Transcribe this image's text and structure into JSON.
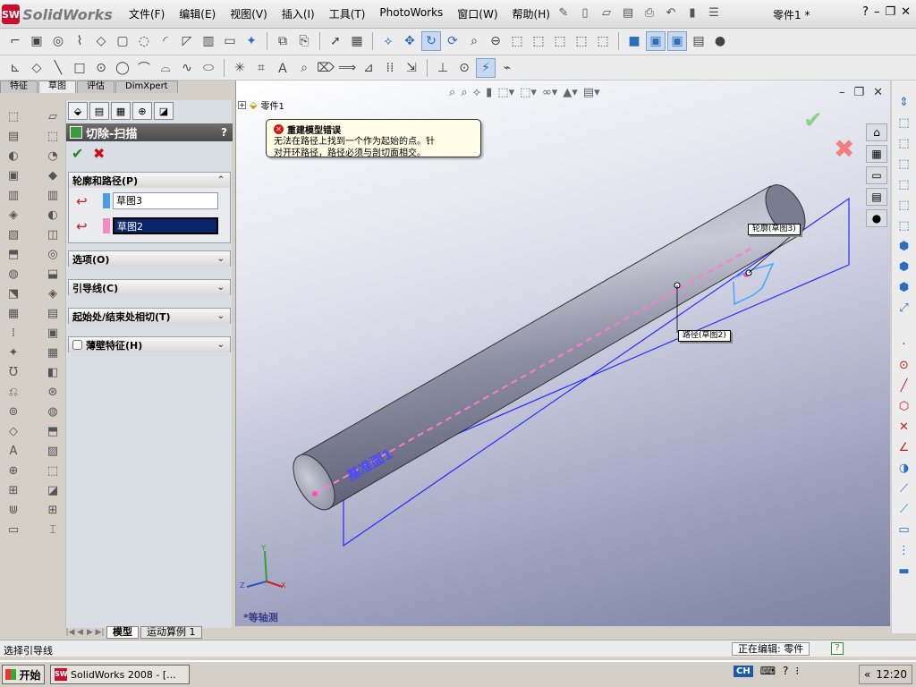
{
  "app": {
    "logo_text": "SolidWorks",
    "menu": [
      "文件(F)",
      "编辑(E)",
      "视图(V)",
      "插入(I)",
      "工具(T)",
      "PhotoWorks",
      "窗口(W)",
      "帮助(H)"
    ],
    "document_title": "零件1 *",
    "help_label": "?"
  },
  "left_tabs": [
    "特征",
    "草图",
    "评估",
    "DimXpert"
  ],
  "active_left_tab": "草图",
  "property_manager": {
    "title": "切除-扫描",
    "help": "?",
    "group_profile_path": {
      "title": "轮廓和路径(P)",
      "profile_value": "草图3",
      "path_value": "草图2",
      "profile_color": "#4a9ee8",
      "path_color": "#f08cc0"
    },
    "collapsed_groups": [
      "选项(O)",
      "引导线(C)",
      "起始处/结束处相切(T)"
    ],
    "thin_feature": "薄壁特征(H)"
  },
  "bottom_tabs": [
    "模型",
    "运动算例 1"
  ],
  "viewport": {
    "tree_item": "零件1",
    "error": {
      "title": "重建模型错误",
      "line1": "无法在路径上找到一个作为起始的点。针",
      "line2": "对开环路径，路径必须与剖切面相交。"
    },
    "plane_label": "基准面1",
    "profile_callout": "轮廓(草图3)",
    "path_callout": "路径(草图2)",
    "view_name": "*等轴测",
    "triad": [
      "X",
      "Y",
      "Z"
    ]
  },
  "status_bar": {
    "message": "选择引导线",
    "editing": "正在编辑: 零件"
  },
  "taskbar": {
    "start_label": "开始",
    "task_label": "SolidWorks 2008 - [...",
    "ime": "CH",
    "time": "12:20"
  }
}
